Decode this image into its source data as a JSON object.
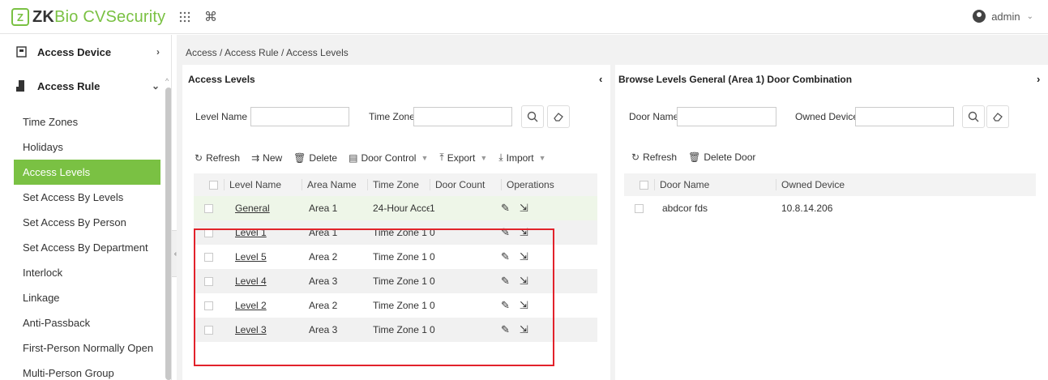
{
  "app": {
    "logo_mark": "Z",
    "name_zk": "ZK",
    "name_bio": "Bio",
    "name_rest": " CVSecurity"
  },
  "header": {
    "user": "admin"
  },
  "sidebar": {
    "sections": [
      {
        "label": "Access Device",
        "arrow": "›"
      },
      {
        "label": "Access Rule",
        "arrow": "⌄"
      }
    ],
    "items": [
      {
        "label": "Time Zones"
      },
      {
        "label": "Holidays"
      },
      {
        "label": "Access Levels"
      },
      {
        "label": "Set Access By Levels"
      },
      {
        "label": "Set Access By Person"
      },
      {
        "label": "Set Access By Department"
      },
      {
        "label": "Interlock"
      },
      {
        "label": "Linkage"
      },
      {
        "label": "Anti-Passback"
      },
      {
        "label": "First-Person Normally Open"
      },
      {
        "label": "Multi-Person Group"
      }
    ]
  },
  "breadcrumb": "Access / Access Rule / Access Levels",
  "left_panel": {
    "title": "Access Levels",
    "toggle": "‹",
    "filter": {
      "level_name_label": "Level Name",
      "level_name_value": "",
      "time_zone_label": "Time Zone",
      "time_zone_value": ""
    },
    "toolbar": {
      "refresh": "Refresh",
      "new": "New",
      "delete": "Delete",
      "door_control": "Door Control",
      "export": "Export",
      "import": "Import"
    },
    "columns": [
      "Level Name",
      "Area Name",
      "Time Zone",
      "Door Count",
      "Operations"
    ],
    "rows": [
      {
        "level": "General",
        "area": "Area 1",
        "tz": "24-Hour Acce",
        "doors": "1"
      },
      {
        "level": "Level 1",
        "area": "Area 1",
        "tz": "Time Zone 1",
        "doors": "0"
      },
      {
        "level": "Level 5",
        "area": "Area 2",
        "tz": "Time Zone 1",
        "doors": "0"
      },
      {
        "level": "Level 4",
        "area": "Area 3",
        "tz": "Time Zone 1",
        "doors": "0"
      },
      {
        "level": "Level 2",
        "area": "Area 2",
        "tz": "Time Zone 1",
        "doors": "0"
      },
      {
        "level": "Level 3",
        "area": "Area 3",
        "tz": "Time Zone 1",
        "doors": "0"
      }
    ]
  },
  "right_panel": {
    "title": "Browse Levels General  (Area 1)  Door Combination",
    "toggle": "›",
    "filter": {
      "door_name_label": "Door Name",
      "door_name_value": "",
      "owned_device_label": "Owned Device",
      "owned_device_value": ""
    },
    "toolbar": {
      "refresh": "Refresh",
      "delete_door": "Delete Door"
    },
    "columns": [
      "Door Name",
      "Owned Device"
    ],
    "rows": [
      {
        "door": "abdcor fds",
        "device": "10.8.14.206"
      }
    ]
  },
  "colors": {
    "accent": "#7ac143",
    "highlight": "#e2222b"
  },
  "icons": [
    "grid-icon",
    "command-icon",
    "user-icon",
    "search-icon",
    "eraser-icon",
    "refresh-icon",
    "new-icon",
    "trash-icon",
    "door-control-icon",
    "export-icon",
    "import-icon",
    "edit-icon",
    "open-icon"
  ]
}
